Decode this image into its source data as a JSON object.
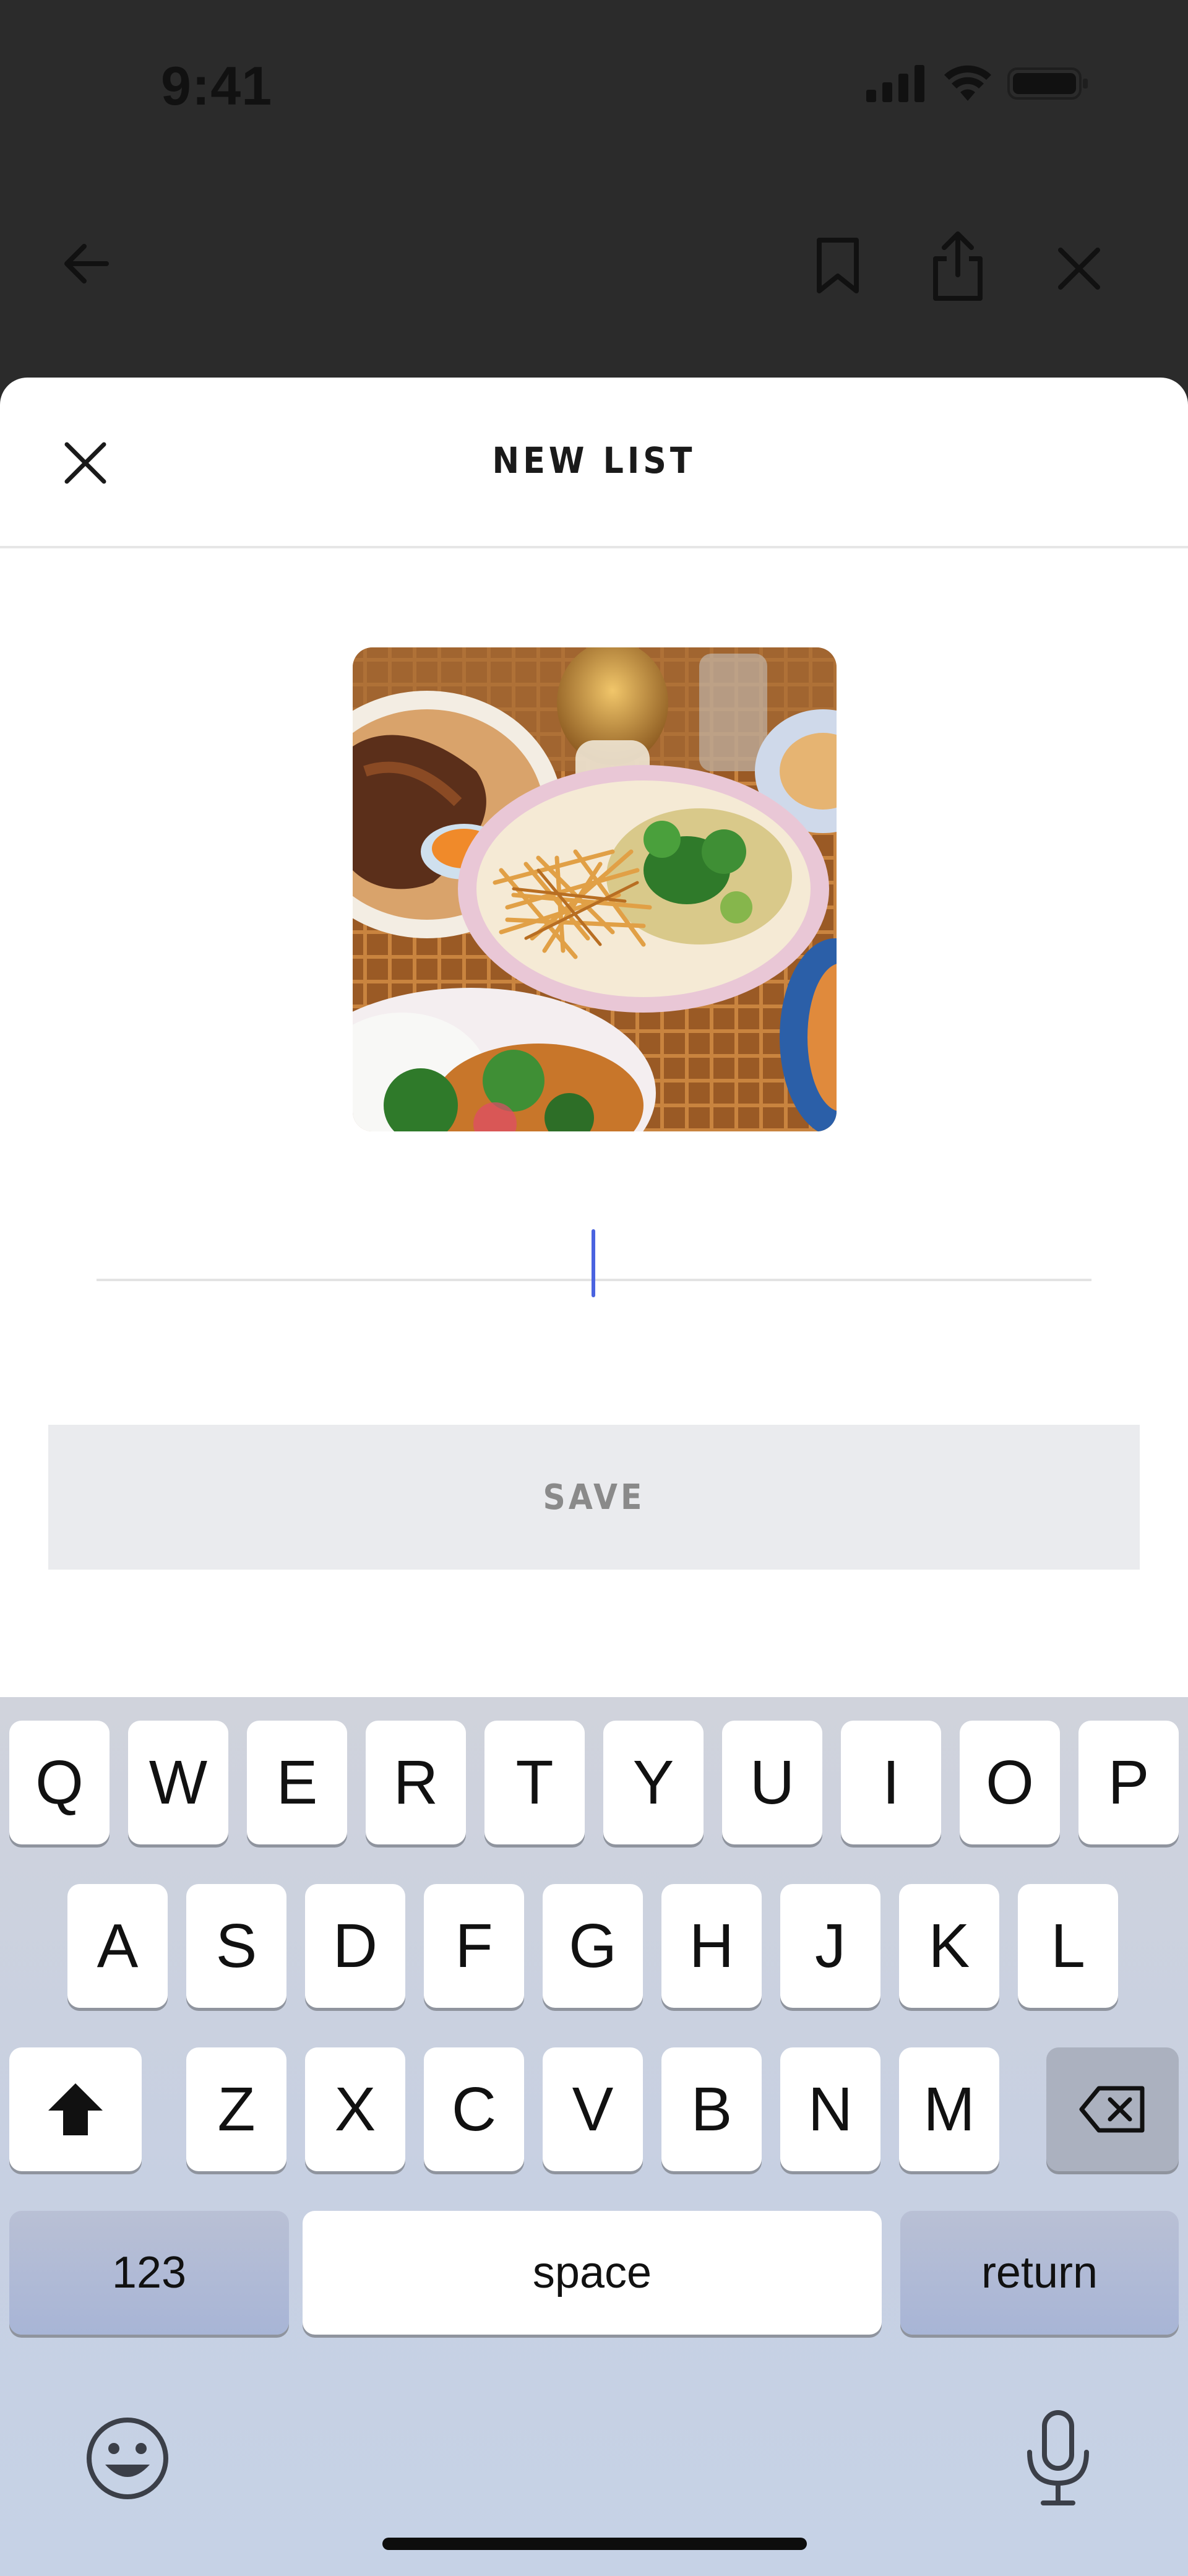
{
  "status_bar": {
    "time": "9:41"
  },
  "top_bar": {
    "back_icon": "arrow-left-icon",
    "bookmark_icon": "bookmark-icon",
    "share_icon": "share-icon",
    "close_icon": "close-icon"
  },
  "sheet": {
    "title": "NEW LIST",
    "close_icon": "close-icon",
    "cover_image": "food-dish-photo",
    "name_input": {
      "value": "",
      "placeholder": ""
    },
    "save_label": "SAVE"
  },
  "keyboard": {
    "row1": [
      "Q",
      "W",
      "E",
      "R",
      "T",
      "Y",
      "U",
      "I",
      "O",
      "P"
    ],
    "row2": [
      "A",
      "S",
      "D",
      "F",
      "G",
      "H",
      "J",
      "K",
      "L"
    ],
    "row3": [
      "Z",
      "X",
      "C",
      "V",
      "B",
      "N",
      "M"
    ],
    "numbers_label": "123",
    "space_label": "space",
    "return_label": "return",
    "shift_icon": "shift-icon",
    "delete_icon": "backspace-icon",
    "emoji_icon": "emoji-icon",
    "mic_icon": "microphone-icon"
  },
  "colors": {
    "background_dim": "#2b2b2b",
    "caret": "#4a63e0",
    "save_bg": "#eaebee",
    "save_text": "#8a8a8a"
  }
}
